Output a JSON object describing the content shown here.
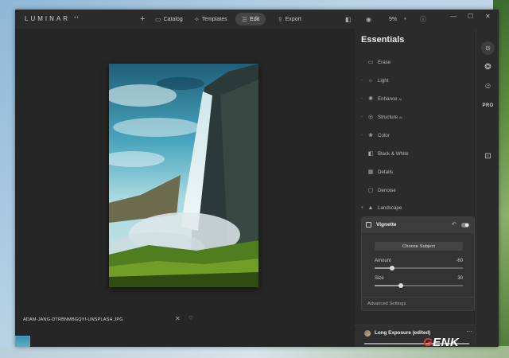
{
  "app": {
    "logo": "LUMINAR",
    "version": "4.1"
  },
  "titlebar": {
    "add_icon": "plus-icon",
    "catalog_label": "Catalog",
    "templates_label": "Templates",
    "edit_label": "Edit",
    "export_label": "Export",
    "zoom": "9%"
  },
  "canvas": {
    "filename": "ADAM-JANG-DTRBNMBGQYI-UNSPLASH.JPG"
  },
  "panel": {
    "title": "Essentials",
    "tools": [
      {
        "label": "Erase",
        "icon": "erase-icon"
      },
      {
        "label": "Light",
        "icon": "sun-icon"
      },
      {
        "label": "Enhance",
        "icon": "enhance-icon",
        "ai": "AI"
      },
      {
        "label": "Structure",
        "icon": "structure-icon",
        "ai": "AI"
      },
      {
        "label": "Color",
        "icon": "color-icon"
      },
      {
        "label": "Black & White",
        "icon": "bw-icon"
      },
      {
        "label": "Details",
        "icon": "details-icon"
      },
      {
        "label": "Denoise",
        "icon": "denoise-icon"
      },
      {
        "label": "Landscape",
        "icon": "landscape-icon"
      }
    ],
    "vignette": {
      "title": "Vignette",
      "choose_subject": "Choose Subject",
      "amount_label": "Amount",
      "amount_value": "-60",
      "amount_fraction": 0.2,
      "size_label": "Size",
      "size_value": "30",
      "size_fraction": 0.3,
      "advanced_label": "Advanced Settings",
      "enabled": true
    },
    "preset": {
      "name": "Long Exposure (edited)"
    }
  },
  "colors": {
    "window_bg": "#262626",
    "panel_bg": "#2b2b2b",
    "accent_thumb": "#4aa3df",
    "watermark_red": "#e43a2f"
  },
  "watermark": {
    "prefix": "G",
    "rest": "ENK"
  }
}
